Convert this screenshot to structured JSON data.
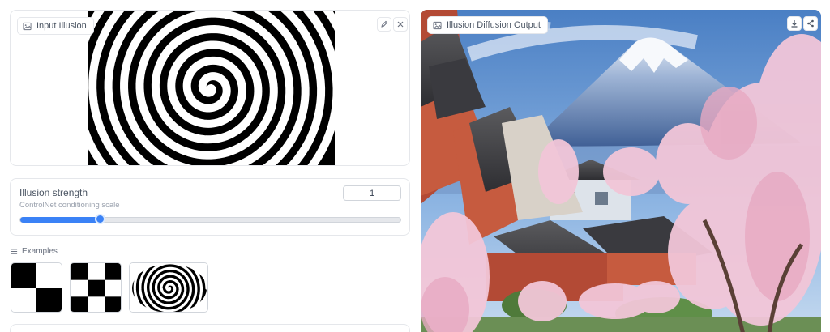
{
  "input_panel": {
    "label": "Input Illusion",
    "edit_icon": "pencil-icon",
    "clear_icon": "close-icon"
  },
  "strength": {
    "title": "Illusion strength",
    "subtitle": "ControlNet conditioning scale",
    "value": "1",
    "slider_fraction": 0.21
  },
  "examples": {
    "label": "Examples",
    "items": [
      "checkerboard-large",
      "checkerboard-small",
      "spiral"
    ]
  },
  "output_panel": {
    "label": "Illusion Diffusion Output",
    "download_icon": "download-icon",
    "share_icon": "share-icon"
  },
  "colors": {
    "accent": "#3b82f6",
    "border": "#e5e7eb"
  }
}
